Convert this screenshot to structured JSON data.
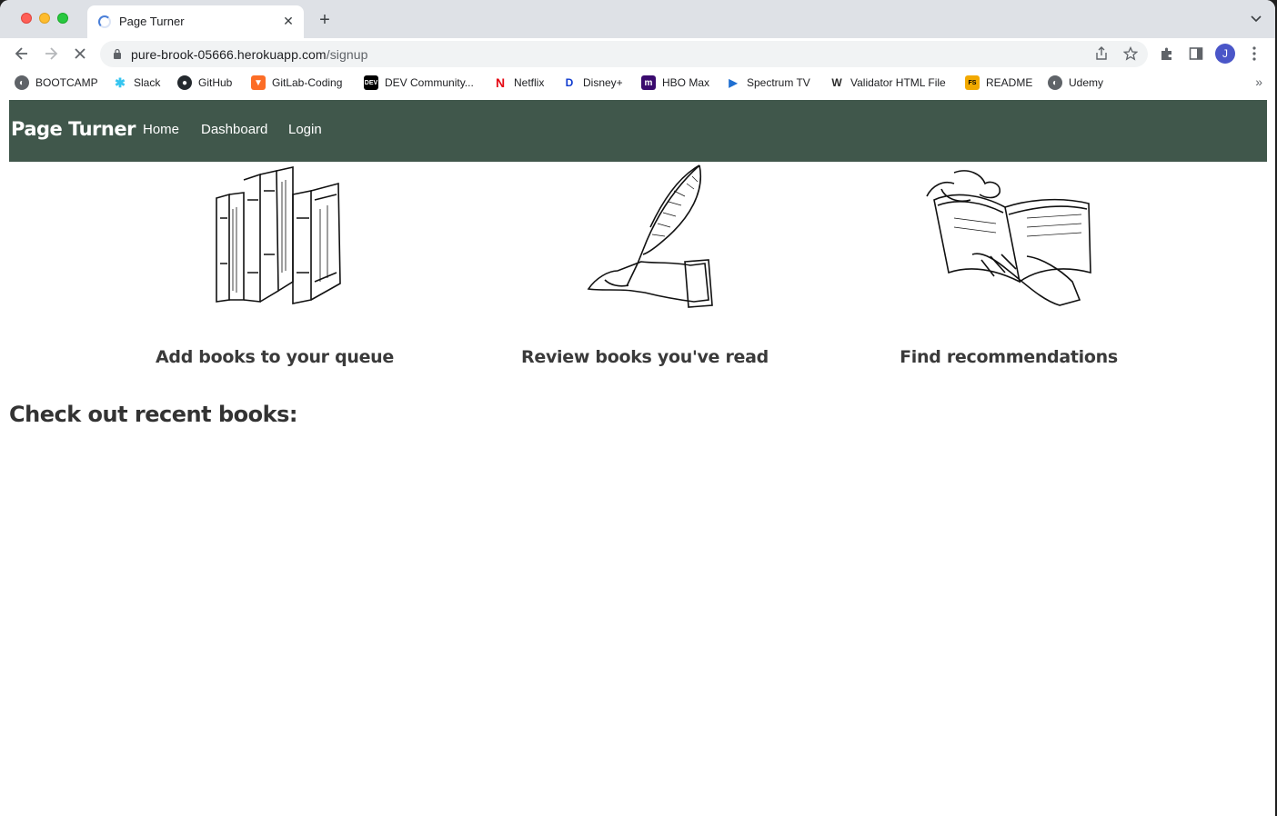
{
  "browser": {
    "tab_title": "Page Turner",
    "url_host": "pure-brook-05666.herokuapp.com",
    "url_path": "/signup",
    "profile_initial": "J",
    "bookmarks": [
      {
        "label": "BOOTCAMP",
        "icon": "globe-icon",
        "color": "#5f6368"
      },
      {
        "label": "Slack",
        "icon": "slack-icon",
        "color": "#36c5f0"
      },
      {
        "label": "GitHub",
        "icon": "github-icon",
        "color": "#24292e"
      },
      {
        "label": "GitLab-Coding",
        "icon": "gitlab-icon",
        "color": "#fc6d26"
      },
      {
        "label": "DEV Community...",
        "icon": "dev-icon",
        "color": "#000000"
      },
      {
        "label": "Netflix",
        "icon": "netflix-icon",
        "color": "#e50914"
      },
      {
        "label": "Disney+",
        "icon": "disney-icon",
        "color": "#113ccf"
      },
      {
        "label": "HBO Max",
        "icon": "hbomax-icon",
        "color": "#5b1fa4"
      },
      {
        "label": "Spectrum TV",
        "icon": "spectrum-icon",
        "color": "#1f6fd1"
      },
      {
        "label": "Validator HTML File",
        "icon": "validator-icon",
        "color": "#2b2b2b"
      },
      {
        "label": "README",
        "icon": "readme-icon",
        "color": "#f2a900"
      },
      {
        "label": "Udemy",
        "icon": "globe-icon",
        "color": "#5f6368"
      }
    ]
  },
  "site": {
    "brand": "Page Turner",
    "nav": [
      "Home",
      "Dashboard",
      "Login"
    ],
    "nav_color": "#40574b",
    "features": [
      {
        "caption": "Add books to your queue",
        "icon": "books-stack-icon"
      },
      {
        "caption": "Review books you've read",
        "icon": "quill-hand-icon"
      },
      {
        "caption": "Find recommendations",
        "icon": "open-book-hands-icon"
      }
    ],
    "recent_heading": "Check out recent books:"
  }
}
